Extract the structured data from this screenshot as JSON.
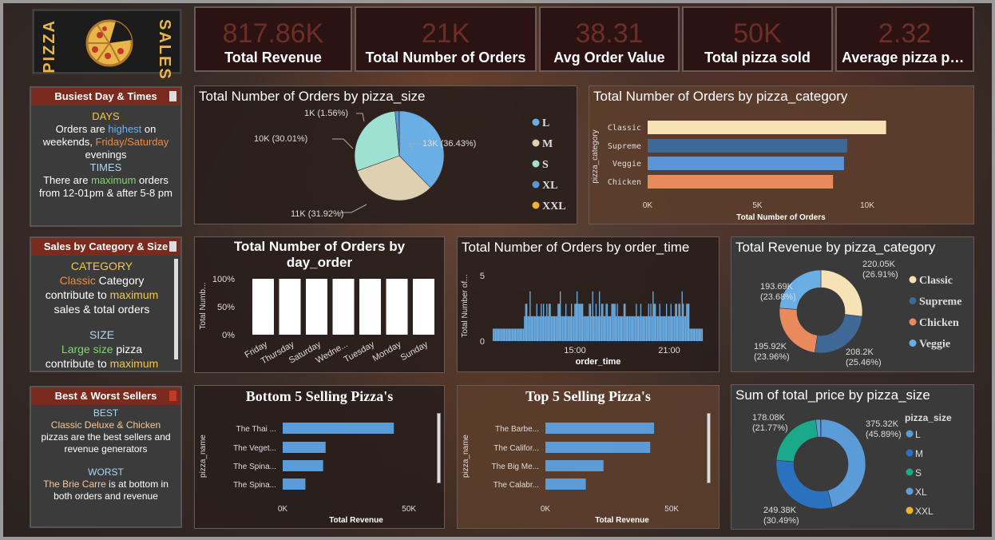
{
  "logo": {
    "left_word": "PIZZA",
    "right_word": "SALES"
  },
  "kpis": [
    {
      "value": "817.86K",
      "label": "Total Revenue"
    },
    {
      "value": "21K",
      "label": "Total Number of Orders"
    },
    {
      "value": "38.31",
      "label": "Avg Order Value"
    },
    {
      "value": "50K",
      "label": "Total pizza sold"
    },
    {
      "value": "2.32",
      "label": "Average pizza pe..."
    }
  ],
  "busiest": {
    "header": "Busiest Day & Times",
    "days_title": "DAYS",
    "line1a": "Orders are ",
    "line1b": "highest",
    "line1c": " on",
    "line2a": "weekends, ",
    "line2b": "Friday/Saturday",
    "line3": "evenings",
    "times_title": "TIMES",
    "line4a": "There are ",
    "line4b": "maximum",
    "line4c": " orders",
    "line5": "from 12-01pm & after 5-8 pm"
  },
  "category_size": {
    "header": "Sales by Category & Size",
    "cat_title": "CATEGORY",
    "line1a": "Classic",
    "line1b": " Category",
    "line2a": "contribute to ",
    "line2b": "maximum",
    "line3": "sales & total orders",
    "size_title": "SIZE",
    "line4a": "Large size",
    "line4b": " pizza",
    "line5a": "contribute to ",
    "line5b": "maximum"
  },
  "best_worst": {
    "header": "Best & Worst Sellers",
    "best_title": "BEST",
    "best_names": "Classic Deluxe & Chicken",
    "best_line2": "pizzas are the best sellers and",
    "best_line3": "revenue generators",
    "worst_title": "WORST",
    "worst_name": "The Brie Carre",
    "worst_line1b": " is at bottom in",
    "worst_line2": "both orders and revenue"
  },
  "chart_data": [
    {
      "id": "orders_by_size",
      "type": "pie",
      "title": "Total Number of Orders by pizza_size",
      "slices": [
        {
          "name": "L",
          "value": 13,
          "label": "13K (36.43%)",
          "color": "#6aaee6"
        },
        {
          "name": "M",
          "value": 11,
          "label": "11K (31.92%)",
          "color": "#ddd1b2"
        },
        {
          "name": "S",
          "value": 10,
          "label": "10K (30.01%)",
          "color": "#9ee0d2"
        },
        {
          "name": "XL",
          "value": 0.5,
          "label": "1K (1.56%)",
          "color": "#5b95d6"
        },
        {
          "name": "XXL",
          "value": 0.03,
          "label": "",
          "color": "#f2b22e"
        }
      ]
    },
    {
      "id": "orders_by_category",
      "type": "bar",
      "title": "Total Number of Orders by pizza_category",
      "ylabel": "pizza_category",
      "xlabel": "Total Number of Orders",
      "categories": [
        "Classic",
        "Supreme",
        "Veggie",
        "Chicken"
      ],
      "values": [
        10859,
        9085,
        8941,
        8443
      ],
      "colors": [
        "#f6e2b5",
        "#3f6896",
        "#5b95d6",
        "#e88a5c"
      ],
      "xticks": [
        "0K",
        "5K",
        "10K"
      ],
      "xlim": [
        0,
        12000
      ]
    },
    {
      "id": "orders_by_day",
      "type": "bar",
      "title_line1": "Total Number of Orders by",
      "title_line2": "day_order",
      "ylabel": "Total Numb...",
      "categories": [
        "Friday",
        "Thursday",
        "Saturday",
        "Wedne...",
        "Tuesday",
        "Monday",
        "Sunday"
      ],
      "values": [
        100,
        100,
        100,
        100,
        100,
        100,
        100
      ],
      "yticks": [
        "100%",
        "50%",
        "0%"
      ]
    },
    {
      "id": "orders_by_time",
      "type": "bar",
      "title": "Total Number of Orders by order_time",
      "ylabel": "Total Number of...",
      "xlabel": "order_time",
      "yticks": [
        "5",
        "0"
      ],
      "xticks": [
        "15:00",
        "21:00"
      ]
    },
    {
      "id": "revenue_by_category",
      "type": "pie",
      "title": "Total Revenue by pizza_category",
      "slices": [
        {
          "name": "Classic",
          "value": 220.05,
          "label1": "220.05K",
          "label2": "(26.91%)",
          "color": "#f6e2b5"
        },
        {
          "name": "Supreme",
          "value": 208.2,
          "label1": "208.2K",
          "label2": "(25.46%)",
          "color": "#3f6896"
        },
        {
          "name": "Chicken",
          "value": 195.92,
          "label1": "195.92K",
          "label2": "(23.96%)",
          "color": "#e88a5c"
        },
        {
          "name": "Veggie",
          "value": 193.69,
          "label1": "193.69K",
          "label2": "(23.68%)",
          "color": "#6aaee6"
        }
      ]
    },
    {
      "id": "bottom5",
      "type": "bar",
      "title": "Bottom 5 Selling Pizza's",
      "ylabel": "pizza_name",
      "xlabel": "Total Revenue",
      "categories": [
        "The Thai ...",
        "The Veget...",
        "The Spina...",
        "The Spina..."
      ],
      "values": [
        44000,
        17000,
        16000,
        9000
      ],
      "xticks": [
        "0K",
        "50K"
      ],
      "xlim": [
        0,
        55000
      ]
    },
    {
      "id": "top5",
      "type": "bar",
      "title": "Top 5 Selling Pizza's",
      "ylabel": "pizza_name",
      "xlabel": "Total Revenue",
      "categories": [
        "The Barbe...",
        "The Califor...",
        "The Big Me...",
        "The Calabr..."
      ],
      "values": [
        43000,
        41500,
        23000,
        16000
      ],
      "xticks": [
        "0K",
        "50K"
      ],
      "xlim": [
        0,
        55000
      ]
    },
    {
      "id": "price_by_size",
      "type": "pie",
      "title": "Sum of total_price by pizza_size",
      "legend_title": "pizza_size",
      "slices": [
        {
          "name": "L",
          "value": 375.32,
          "label1": "375.32K",
          "label2": "(45.89%)",
          "color": "#5b9bd8"
        },
        {
          "name": "M",
          "value": 249.38,
          "label1": "249.38K",
          "label2": "(30.49%)",
          "color": "#2a72c0"
        },
        {
          "name": "S",
          "value": 178.08,
          "label1": "178.08K",
          "label2": "(21.77%)",
          "color": "#1aa98a"
        },
        {
          "name": "XL",
          "value": 14.08,
          "label1": "",
          "label2": "",
          "color": "#5f9fd9"
        },
        {
          "name": "XXL",
          "value": 1.01,
          "label1": "",
          "label2": "",
          "color": "#f2b22e"
        }
      ]
    }
  ]
}
